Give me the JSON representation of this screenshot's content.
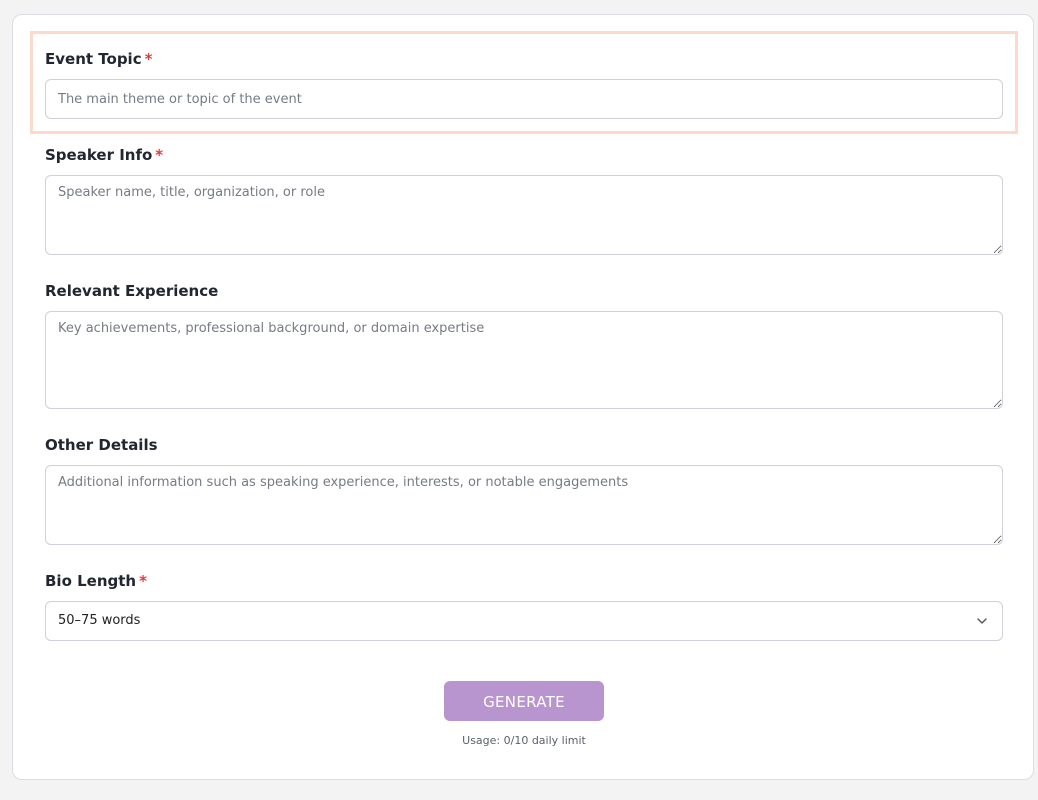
{
  "form": {
    "event_topic": {
      "label": "Event Topic",
      "required_mark": "*",
      "value": "",
      "placeholder": "The main theme or topic of the event"
    },
    "speaker_info": {
      "label": "Speaker Info",
      "required_mark": "*",
      "value": "",
      "placeholder": "Speaker name, title, organization, or role"
    },
    "relevant_experience": {
      "label": "Relevant Experience",
      "value": "",
      "placeholder": "Key achievements, professional background, or domain expertise"
    },
    "other_details": {
      "label": "Other Details",
      "value": "",
      "placeholder": "Additional information such as speaking experience, interests, or notable engagements"
    },
    "bio_length": {
      "label": "Bio Length",
      "required_mark": "*",
      "selected": "50–75 words",
      "icon": "chevron-down-icon"
    },
    "generate_button": {
      "label": "GENERATE"
    },
    "usage": "Usage: 0/10 daily limit"
  },
  "colors": {
    "accent": "#b995d0",
    "required": "#e23b3b",
    "highlight_border": "#fbd9cd",
    "input_border": "#cfd0da"
  }
}
